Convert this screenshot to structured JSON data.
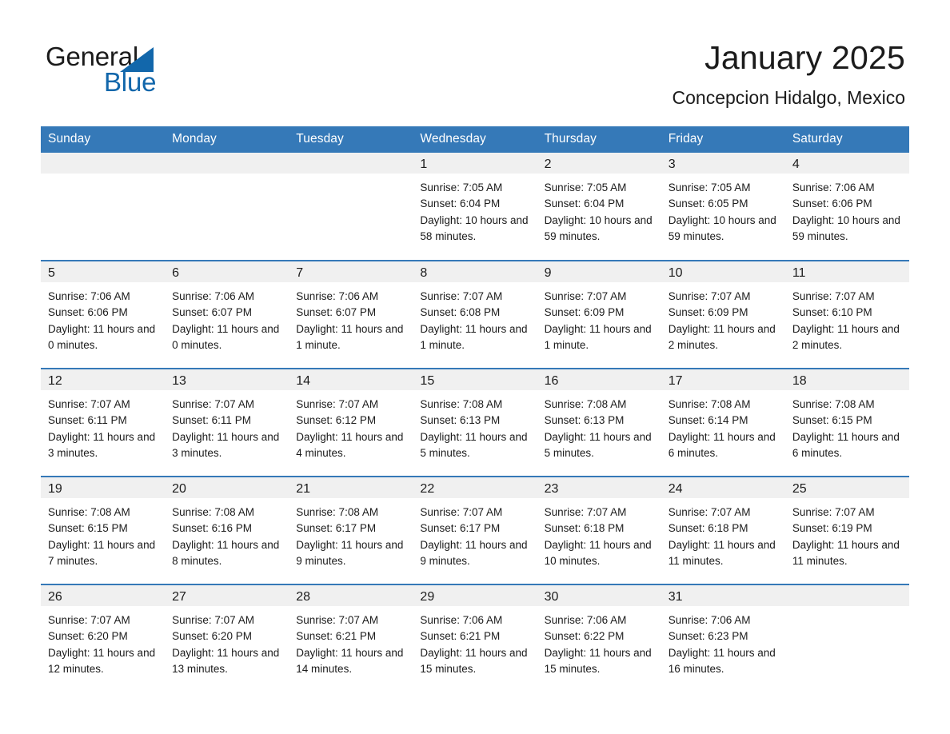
{
  "brand": {
    "name_part1": "General",
    "name_part2": "Blue",
    "colors": {
      "blue": "#1267ab",
      "header_blue": "#3579b8",
      "day_band_gray": "#f0f0f0",
      "text": "#1b1b1b"
    }
  },
  "header": {
    "title": "January 2025",
    "subtitle": "Concepcion Hidalgo, Mexico"
  },
  "weekdays": [
    "Sunday",
    "Monday",
    "Tuesday",
    "Wednesday",
    "Thursday",
    "Friday",
    "Saturday"
  ],
  "weeks": [
    [
      {
        "day": "",
        "blank": true
      },
      {
        "day": "",
        "blank": true
      },
      {
        "day": "",
        "blank": true
      },
      {
        "day": "1",
        "sunrise": "Sunrise: 7:05 AM",
        "sunset": "Sunset: 6:04 PM",
        "daylight": "Daylight: 10 hours and 58 minutes."
      },
      {
        "day": "2",
        "sunrise": "Sunrise: 7:05 AM",
        "sunset": "Sunset: 6:04 PM",
        "daylight": "Daylight: 10 hours and 59 minutes."
      },
      {
        "day": "3",
        "sunrise": "Sunrise: 7:05 AM",
        "sunset": "Sunset: 6:05 PM",
        "daylight": "Daylight: 10 hours and 59 minutes."
      },
      {
        "day": "4",
        "sunrise": "Sunrise: 7:06 AM",
        "sunset": "Sunset: 6:06 PM",
        "daylight": "Daylight: 10 hours and 59 minutes."
      }
    ],
    [
      {
        "day": "5",
        "sunrise": "Sunrise: 7:06 AM",
        "sunset": "Sunset: 6:06 PM",
        "daylight": "Daylight: 11 hours and 0 minutes."
      },
      {
        "day": "6",
        "sunrise": "Sunrise: 7:06 AM",
        "sunset": "Sunset: 6:07 PM",
        "daylight": "Daylight: 11 hours and 0 minutes."
      },
      {
        "day": "7",
        "sunrise": "Sunrise: 7:06 AM",
        "sunset": "Sunset: 6:07 PM",
        "daylight": "Daylight: 11 hours and 1 minute."
      },
      {
        "day": "8",
        "sunrise": "Sunrise: 7:07 AM",
        "sunset": "Sunset: 6:08 PM",
        "daylight": "Daylight: 11 hours and 1 minute."
      },
      {
        "day": "9",
        "sunrise": "Sunrise: 7:07 AM",
        "sunset": "Sunset: 6:09 PM",
        "daylight": "Daylight: 11 hours and 1 minute."
      },
      {
        "day": "10",
        "sunrise": "Sunrise: 7:07 AM",
        "sunset": "Sunset: 6:09 PM",
        "daylight": "Daylight: 11 hours and 2 minutes."
      },
      {
        "day": "11",
        "sunrise": "Sunrise: 7:07 AM",
        "sunset": "Sunset: 6:10 PM",
        "daylight": "Daylight: 11 hours and 2 minutes."
      }
    ],
    [
      {
        "day": "12",
        "sunrise": "Sunrise: 7:07 AM",
        "sunset": "Sunset: 6:11 PM",
        "daylight": "Daylight: 11 hours and 3 minutes."
      },
      {
        "day": "13",
        "sunrise": "Sunrise: 7:07 AM",
        "sunset": "Sunset: 6:11 PM",
        "daylight": "Daylight: 11 hours and 3 minutes."
      },
      {
        "day": "14",
        "sunrise": "Sunrise: 7:07 AM",
        "sunset": "Sunset: 6:12 PM",
        "daylight": "Daylight: 11 hours and 4 minutes."
      },
      {
        "day": "15",
        "sunrise": "Sunrise: 7:08 AM",
        "sunset": "Sunset: 6:13 PM",
        "daylight": "Daylight: 11 hours and 5 minutes."
      },
      {
        "day": "16",
        "sunrise": "Sunrise: 7:08 AM",
        "sunset": "Sunset: 6:13 PM",
        "daylight": "Daylight: 11 hours and 5 minutes."
      },
      {
        "day": "17",
        "sunrise": "Sunrise: 7:08 AM",
        "sunset": "Sunset: 6:14 PM",
        "daylight": "Daylight: 11 hours and 6 minutes."
      },
      {
        "day": "18",
        "sunrise": "Sunrise: 7:08 AM",
        "sunset": "Sunset: 6:15 PM",
        "daylight": "Daylight: 11 hours and 6 minutes."
      }
    ],
    [
      {
        "day": "19",
        "sunrise": "Sunrise: 7:08 AM",
        "sunset": "Sunset: 6:15 PM",
        "daylight": "Daylight: 11 hours and 7 minutes."
      },
      {
        "day": "20",
        "sunrise": "Sunrise: 7:08 AM",
        "sunset": "Sunset: 6:16 PM",
        "daylight": "Daylight: 11 hours and 8 minutes."
      },
      {
        "day": "21",
        "sunrise": "Sunrise: 7:08 AM",
        "sunset": "Sunset: 6:17 PM",
        "daylight": "Daylight: 11 hours and 9 minutes."
      },
      {
        "day": "22",
        "sunrise": "Sunrise: 7:07 AM",
        "sunset": "Sunset: 6:17 PM",
        "daylight": "Daylight: 11 hours and 9 minutes."
      },
      {
        "day": "23",
        "sunrise": "Sunrise: 7:07 AM",
        "sunset": "Sunset: 6:18 PM",
        "daylight": "Daylight: 11 hours and 10 minutes."
      },
      {
        "day": "24",
        "sunrise": "Sunrise: 7:07 AM",
        "sunset": "Sunset: 6:18 PM",
        "daylight": "Daylight: 11 hours and 11 minutes."
      },
      {
        "day": "25",
        "sunrise": "Sunrise: 7:07 AM",
        "sunset": "Sunset: 6:19 PM",
        "daylight": "Daylight: 11 hours and 11 minutes."
      }
    ],
    [
      {
        "day": "26",
        "sunrise": "Sunrise: 7:07 AM",
        "sunset": "Sunset: 6:20 PM",
        "daylight": "Daylight: 11 hours and 12 minutes."
      },
      {
        "day": "27",
        "sunrise": "Sunrise: 7:07 AM",
        "sunset": "Sunset: 6:20 PM",
        "daylight": "Daylight: 11 hours and 13 minutes."
      },
      {
        "day": "28",
        "sunrise": "Sunrise: 7:07 AM",
        "sunset": "Sunset: 6:21 PM",
        "daylight": "Daylight: 11 hours and 14 minutes."
      },
      {
        "day": "29",
        "sunrise": "Sunrise: 7:06 AM",
        "sunset": "Sunset: 6:21 PM",
        "daylight": "Daylight: 11 hours and 15 minutes."
      },
      {
        "day": "30",
        "sunrise": "Sunrise: 7:06 AM",
        "sunset": "Sunset: 6:22 PM",
        "daylight": "Daylight: 11 hours and 15 minutes."
      },
      {
        "day": "31",
        "sunrise": "Sunrise: 7:06 AM",
        "sunset": "Sunset: 6:23 PM",
        "daylight": "Daylight: 11 hours and 16 minutes."
      },
      {
        "day": "",
        "blank": true
      }
    ]
  ]
}
